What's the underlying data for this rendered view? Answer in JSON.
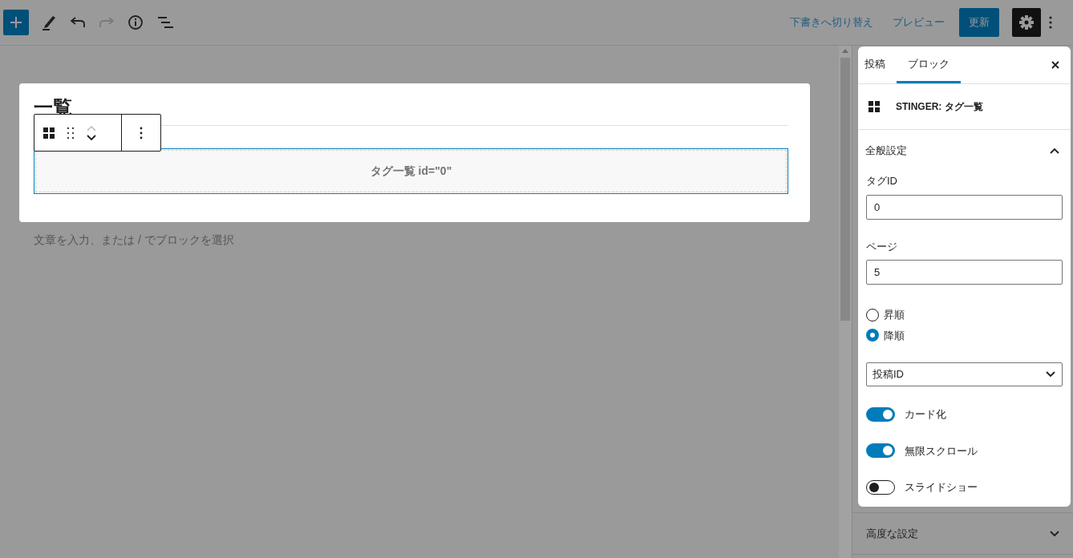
{
  "toolbar": {
    "inserter_active": true,
    "redo_disabled": true,
    "switch_draft": "下書きへ切り替え",
    "preview": "プレビュー",
    "update": "更新",
    "settings_active": true
  },
  "editor": {
    "heading": "一覧",
    "block_preview": "タグ一覧 id=\"0\"",
    "placeholder": "文章を入力、または / でブロックを選択"
  },
  "sidebar": {
    "tabs": [
      {
        "label": "投稿",
        "selected": false
      },
      {
        "label": "ブロック",
        "selected": true
      }
    ],
    "block_title": "STINGER: タグ一覧",
    "general_panel": {
      "title": "全般設定",
      "expanded": true
    },
    "fields": [
      {
        "label": "タグID",
        "value": "0"
      },
      {
        "label": "ページ",
        "value": "5"
      }
    ],
    "order": [
      {
        "label": "昇順",
        "selected": false
      },
      {
        "label": "降順",
        "selected": true
      }
    ],
    "sort_select": {
      "value": "投稿ID"
    },
    "toggles": [
      {
        "label": "カード化",
        "on": true
      },
      {
        "label": "無限スクロール",
        "on": true
      },
      {
        "label": "スライドショー",
        "on": false
      }
    ],
    "advanced_panel": {
      "title": "高度な設定",
      "expanded": false
    }
  }
}
